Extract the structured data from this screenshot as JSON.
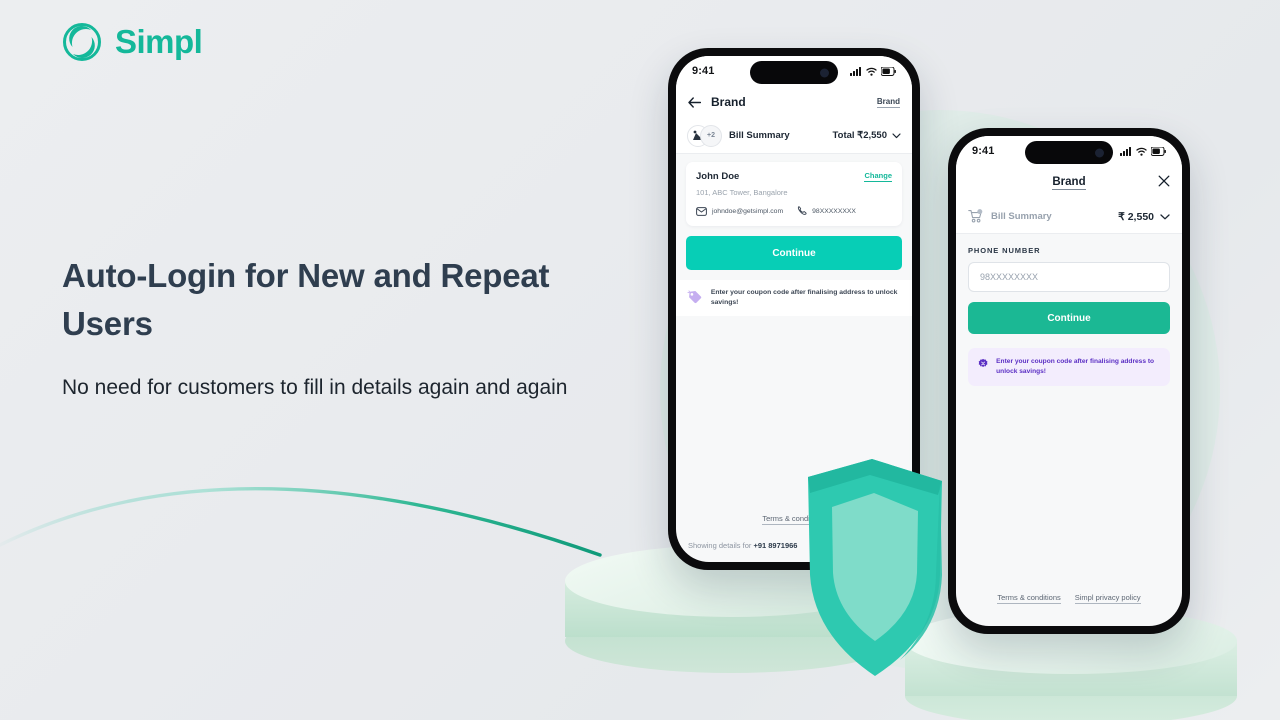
{
  "brand": {
    "logo_text": "Simpl",
    "logo_icon": "simpl-swirl-icon",
    "accent": "#14b89a",
    "teal": "#07ceb6",
    "green": "#1bb894",
    "purple": "#5b2fc4"
  },
  "copy": {
    "headline": "Auto-Login for New and Repeat Users",
    "subcopy": "No need for customers to fill in details again and again"
  },
  "phone_one": {
    "status": {
      "time": "9:41",
      "signal": "cellular-signal-icon",
      "wifi": "wifi-icon",
      "battery": "battery-icon"
    },
    "nav": {
      "back": "back-arrow-icon",
      "title": "Brand",
      "right_label": "Brand"
    },
    "bill": {
      "badge": "+2",
      "label": "Bill Summary",
      "total": "Total ₹2,550",
      "chevron": "chevron-down-icon"
    },
    "address": {
      "name": "John Doe",
      "change": "Change",
      "line": "101, ABC Tower, Bangalore",
      "email": "johndoe@getsimpl.com",
      "phone": "98XXXXXXXX"
    },
    "continue_label": "Continue",
    "coupon": "Enter your coupon code after finalising address to unlock savings!",
    "terms": "Terms & conditions",
    "showing_prefix": "Showing details for ",
    "showing_number": "+91 8971966"
  },
  "phone_two": {
    "status": {
      "time": "9:41",
      "signal": "cellular-signal-icon",
      "wifi": "wifi-icon",
      "battery": "battery-icon"
    },
    "nav": {
      "title": "Brand",
      "close": "close-icon"
    },
    "bill": {
      "cart": "cart-icon",
      "label": "Bill Summary",
      "total": "₹ 2,550",
      "chevron": "chevron-down-icon"
    },
    "field_label": "PHONE NUMBER",
    "field_placeholder": "98XXXXXXXX",
    "field_value": "",
    "continue_label": "Continue",
    "coupon": "Enter your coupon code after finalising address to unlock savings!",
    "terms": "Terms & conditions",
    "privacy": "Simpl privacy policy"
  },
  "decor": {
    "shield": "security-shield-icon",
    "curve": "accent-curve",
    "podium_a": "display-podium",
    "podium_b": "display-podium"
  }
}
